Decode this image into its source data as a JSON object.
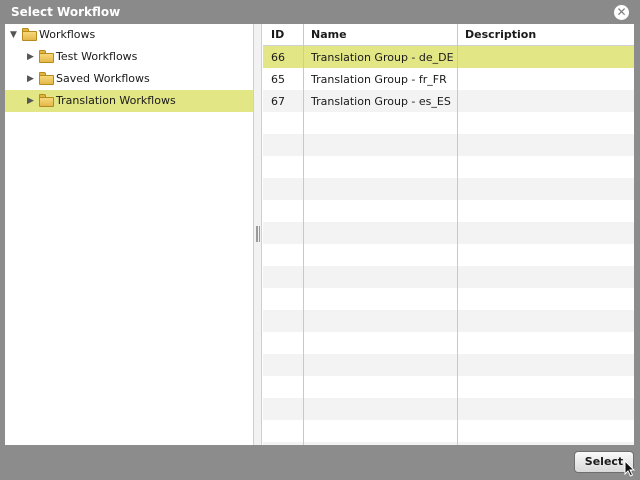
{
  "dialog": {
    "title": "Select Workflow",
    "close_glyph": "✕",
    "select_label": "Select"
  },
  "tree": {
    "root": {
      "label": "Workflows",
      "expanded": true,
      "toggle": "▼"
    },
    "children": [
      {
        "label": "Test Workflows",
        "toggle": "▶",
        "selected": false
      },
      {
        "label": "Saved Workflows",
        "toggle": "▶",
        "selected": false
      },
      {
        "label": "Translation Workflows",
        "toggle": "▶",
        "selected": true
      }
    ]
  },
  "grid": {
    "columns": [
      "ID",
      "Name",
      "Description"
    ],
    "rows": [
      {
        "id": "66",
        "name": "Translation Group - de_DE",
        "description": "",
        "selected": true
      },
      {
        "id": "65",
        "name": "Translation Group - fr_FR",
        "description": "",
        "selected": false
      },
      {
        "id": "67",
        "name": "Translation Group - es_ES",
        "description": "",
        "selected": false
      }
    ]
  },
  "colors": {
    "selection": "#e3e685",
    "frame": "#8a8a8a"
  }
}
